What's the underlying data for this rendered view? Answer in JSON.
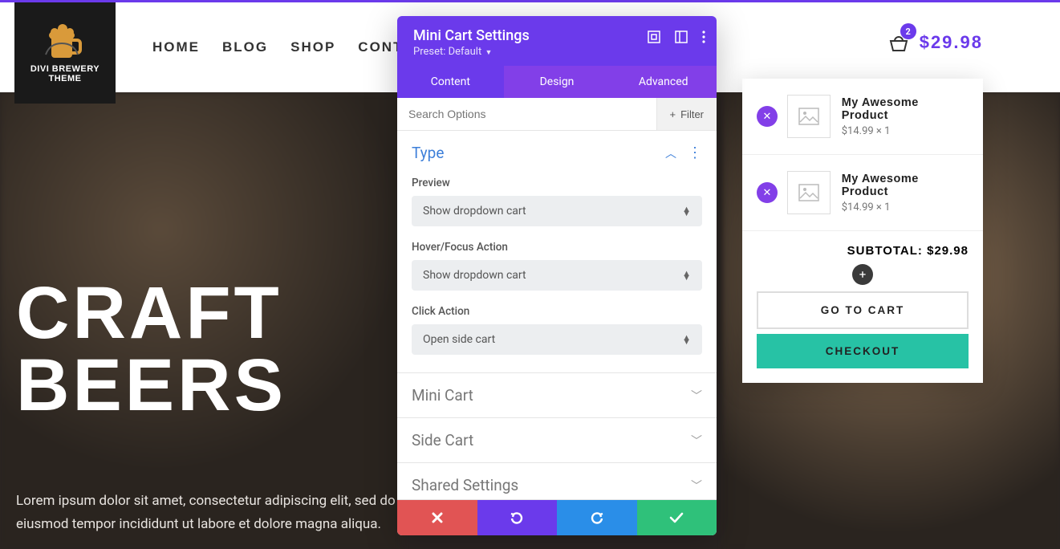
{
  "logo": {
    "name": "DIVI BREWERY THEME"
  },
  "nav": {
    "items": [
      "Home",
      "Blog",
      "Shop",
      "Contact"
    ]
  },
  "cart": {
    "count": "2",
    "total": "$29.98"
  },
  "hero": {
    "title_line1": "CRAFT",
    "title_line2": "BEERS",
    "paragraph": "Lorem ipsum dolor sit amet, consectetur adipiscing elit, sed do eiusmod tempor incididunt ut labore et dolore magna aliqua."
  },
  "panel": {
    "title": "Mini Cart Settings",
    "preset_label": "Preset: Default",
    "tabs": {
      "content": "Content",
      "design": "Design",
      "advanced": "Advanced"
    },
    "search_placeholder": "Search Options",
    "filter_label": "Filter",
    "sections": {
      "type": {
        "title": "Type",
        "preview_label": "Preview",
        "preview_value": "Show dropdown cart",
        "hover_label": "Hover/Focus Action",
        "hover_value": "Show dropdown cart",
        "click_label": "Click Action",
        "click_value": "Open side cart"
      },
      "mini_cart": "Mini Cart",
      "side_cart": "Side Cart",
      "shared": "Shared Settings"
    }
  },
  "mini_cart": {
    "items": [
      {
        "name": "My Awesome Product",
        "price": "$14.99 × 1"
      },
      {
        "name": "My Awesome Product",
        "price": "$14.99 × 1"
      }
    ],
    "subtotal_label": "SUBTOTAL:",
    "subtotal_value": "$29.98",
    "go_to_cart": "GO TO CART",
    "checkout": "CHECKOUT"
  }
}
